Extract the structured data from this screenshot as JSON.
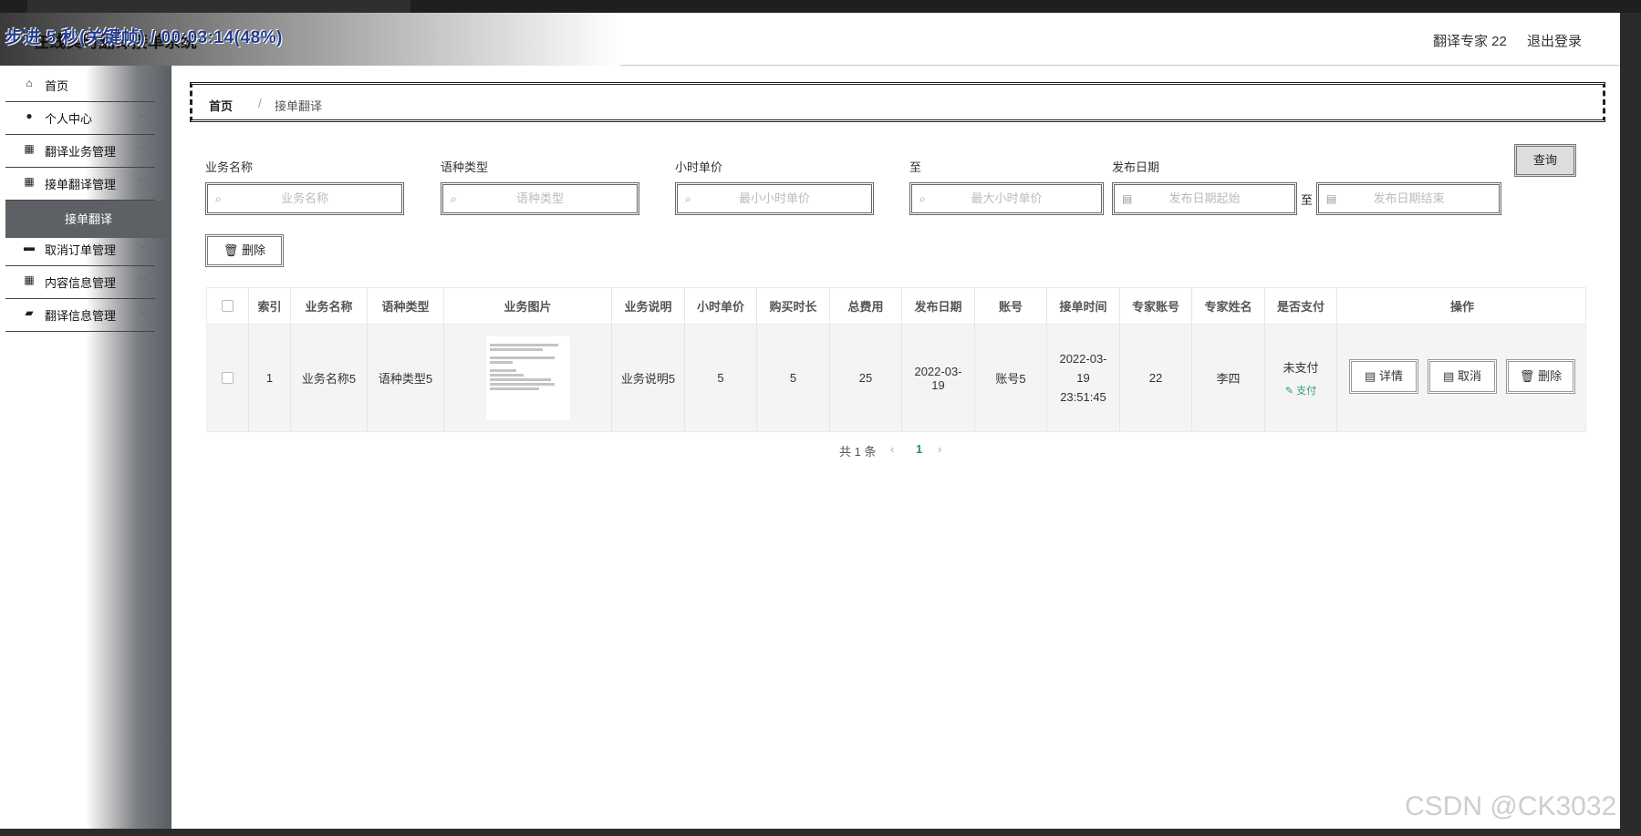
{
  "app": {
    "title": "在线实时翻译接单系统",
    "overlay_text": "步进 5 秒(关键帧) / 00:03:14(48%)",
    "user_label": "翻译专家 22",
    "logout_label": "退出登录"
  },
  "sidebar": {
    "items": [
      {
        "label": "首页",
        "icon": "home-icon"
      },
      {
        "label": "个人中心",
        "icon": "user-icon"
      },
      {
        "label": "翻译业务管理",
        "icon": "grid-icon"
      },
      {
        "label": "接单翻译管理",
        "icon": "grid-icon"
      },
      {
        "label": "接单翻译",
        "icon": ""
      },
      {
        "label": "取消订单管理",
        "icon": "briefcase-icon"
      },
      {
        "label": "内容信息管理",
        "icon": "grid-icon"
      },
      {
        "label": "翻译信息管理",
        "icon": "message-icon"
      }
    ]
  },
  "breadcrumb": {
    "home": "首页",
    "separator": "/",
    "current": "接单翻译"
  },
  "filters": {
    "business_name": {
      "label": "业务名称",
      "placeholder": "业务名称"
    },
    "language_type": {
      "label": "语种类型",
      "placeholder": "语种类型"
    },
    "hourly_price": {
      "label": "小时单价",
      "placeholder": "最小小时单价"
    },
    "to": {
      "label": "至",
      "placeholder": "最大小时单价"
    },
    "publish_date": {
      "label": "发布日期",
      "start_placeholder": "发布日期起始",
      "range_sep": "至",
      "end_placeholder": "发布日期结束"
    },
    "query_label": "查询",
    "delete_label": "删除"
  },
  "table": {
    "headers": [
      "索引",
      "业务名称",
      "语种类型",
      "业务图片",
      "业务说明",
      "小时单价",
      "购买时长",
      "总费用",
      "发布日期",
      "账号",
      "接单时间",
      "专家账号",
      "专家姓名",
      "是否支付",
      "操作"
    ],
    "rows": [
      {
        "index": "1",
        "business_name": "业务名称5",
        "language_type": "语种类型5",
        "description": "业务说明5",
        "hourly_price": "5",
        "duration": "5",
        "total": "25",
        "publish_date": "2022-03-19",
        "account": "账号5",
        "accept_time": "2022-03-19 23:51:45",
        "expert_account": "22",
        "expert_name": "李四",
        "paid_status": "未支付",
        "pay_label": "支付",
        "actions": [
          "详情",
          "取消",
          "删除"
        ]
      }
    ]
  },
  "pagination": {
    "total_text": "共 1 条",
    "current_page": "1"
  },
  "watermark": "CSDN @CK3032"
}
